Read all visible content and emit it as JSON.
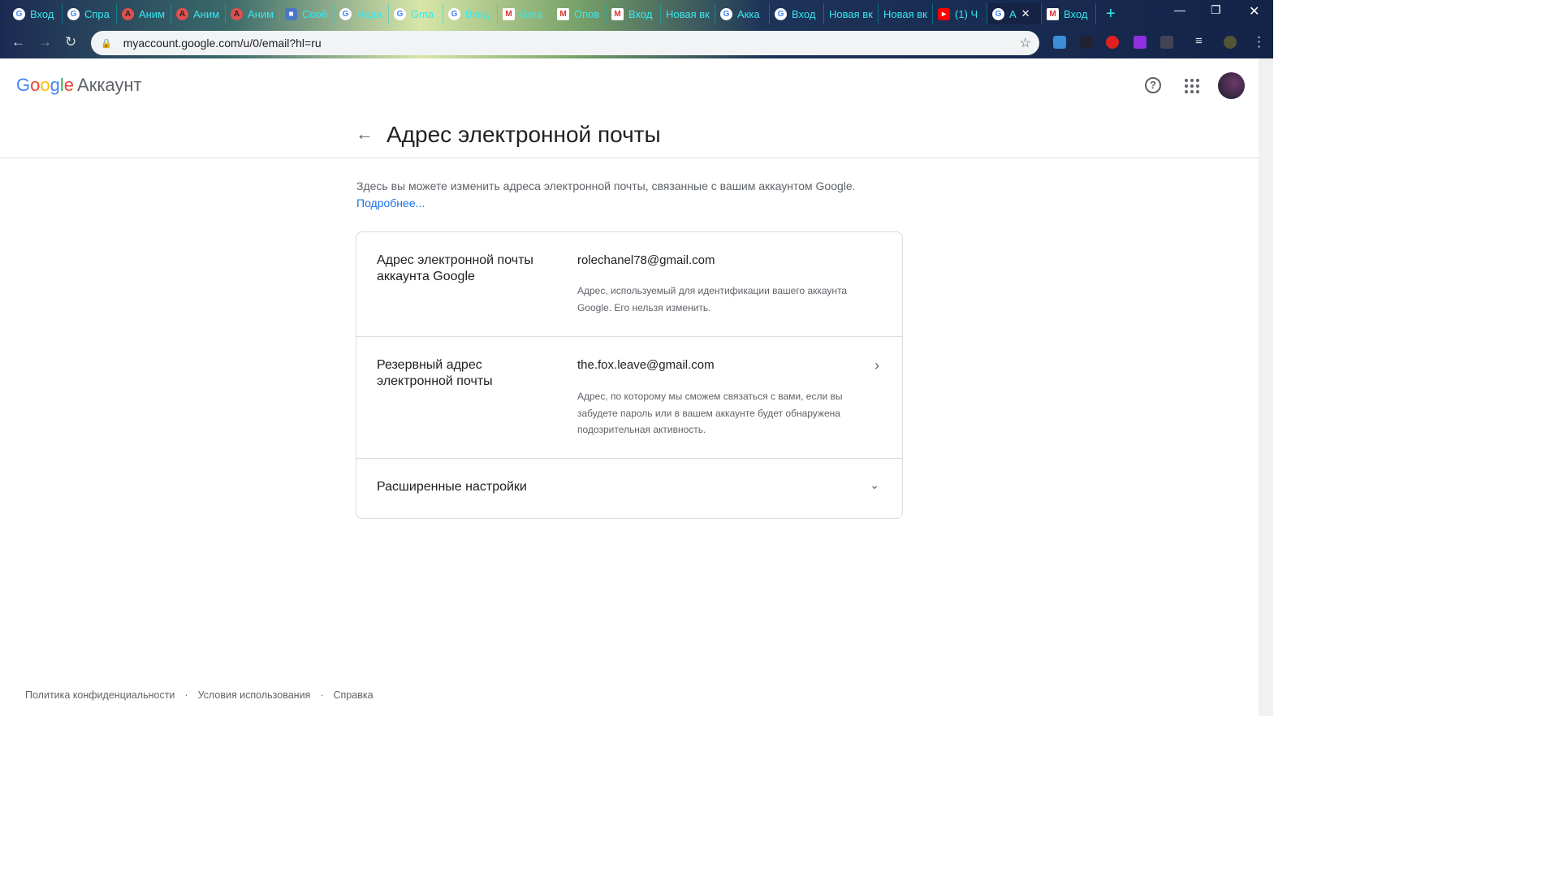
{
  "browser": {
    "tabs": [
      {
        "icon": "google",
        "label": "Вход"
      },
      {
        "icon": "google",
        "label": "Спра"
      },
      {
        "icon": "anime",
        "label": "Аним"
      },
      {
        "icon": "anime",
        "label": "Аним"
      },
      {
        "icon": "anime",
        "label": "Аним"
      },
      {
        "icon": "message",
        "label": "Сооб"
      },
      {
        "icon": "google",
        "label": "Неда"
      },
      {
        "icon": "google",
        "label": "Gma"
      },
      {
        "icon": "google",
        "label": "Вход"
      },
      {
        "icon": "gmail",
        "label": "Gma"
      },
      {
        "icon": "gmail",
        "label": "Опов"
      },
      {
        "icon": "gmail",
        "label": "Вход"
      },
      {
        "icon": "none",
        "label": "Новая вк"
      },
      {
        "icon": "google",
        "label": "Акка"
      },
      {
        "icon": "google",
        "label": "Вход"
      },
      {
        "icon": "none",
        "label": "Новая вк"
      },
      {
        "icon": "none",
        "label": "Новая вк"
      },
      {
        "icon": "youtube",
        "label": "(1) Ч"
      },
      {
        "icon": "google",
        "label": "А"
      },
      {
        "icon": "gmail",
        "label": "Вход"
      }
    ],
    "new_tab": "+",
    "url": "myaccount.google.com/u/0/email?hl=ru"
  },
  "header": {
    "logo": "Google",
    "product": "Аккаунт"
  },
  "page": {
    "title": "Адрес электронной почты",
    "intro": "Здесь вы можете изменить адреса электронной почты, связанные с вашим аккаунтом Google.",
    "more_link": "Подробнее...",
    "rows": [
      {
        "label": "Адрес электронной почты аккаунта Google",
        "value": "rolechanel78@gmail.com",
        "description": "Адрес, используемый для идентификации вашего аккаунта Google. Его нельзя изменить."
      },
      {
        "label": "Резервный адрес электронной почты",
        "value": "the.fox.leave@gmail.com",
        "description": "Адрес, по которому мы сможем связаться с вами, если вы забудете пароль или в вашем аккаунте будет обнаружена подозрительная активность."
      },
      {
        "label": "Расширенные настройки"
      }
    ]
  },
  "footer": {
    "privacy": "Политика конфиденциальности",
    "sep": "·",
    "terms": "Условия использования",
    "help": "Справка"
  }
}
